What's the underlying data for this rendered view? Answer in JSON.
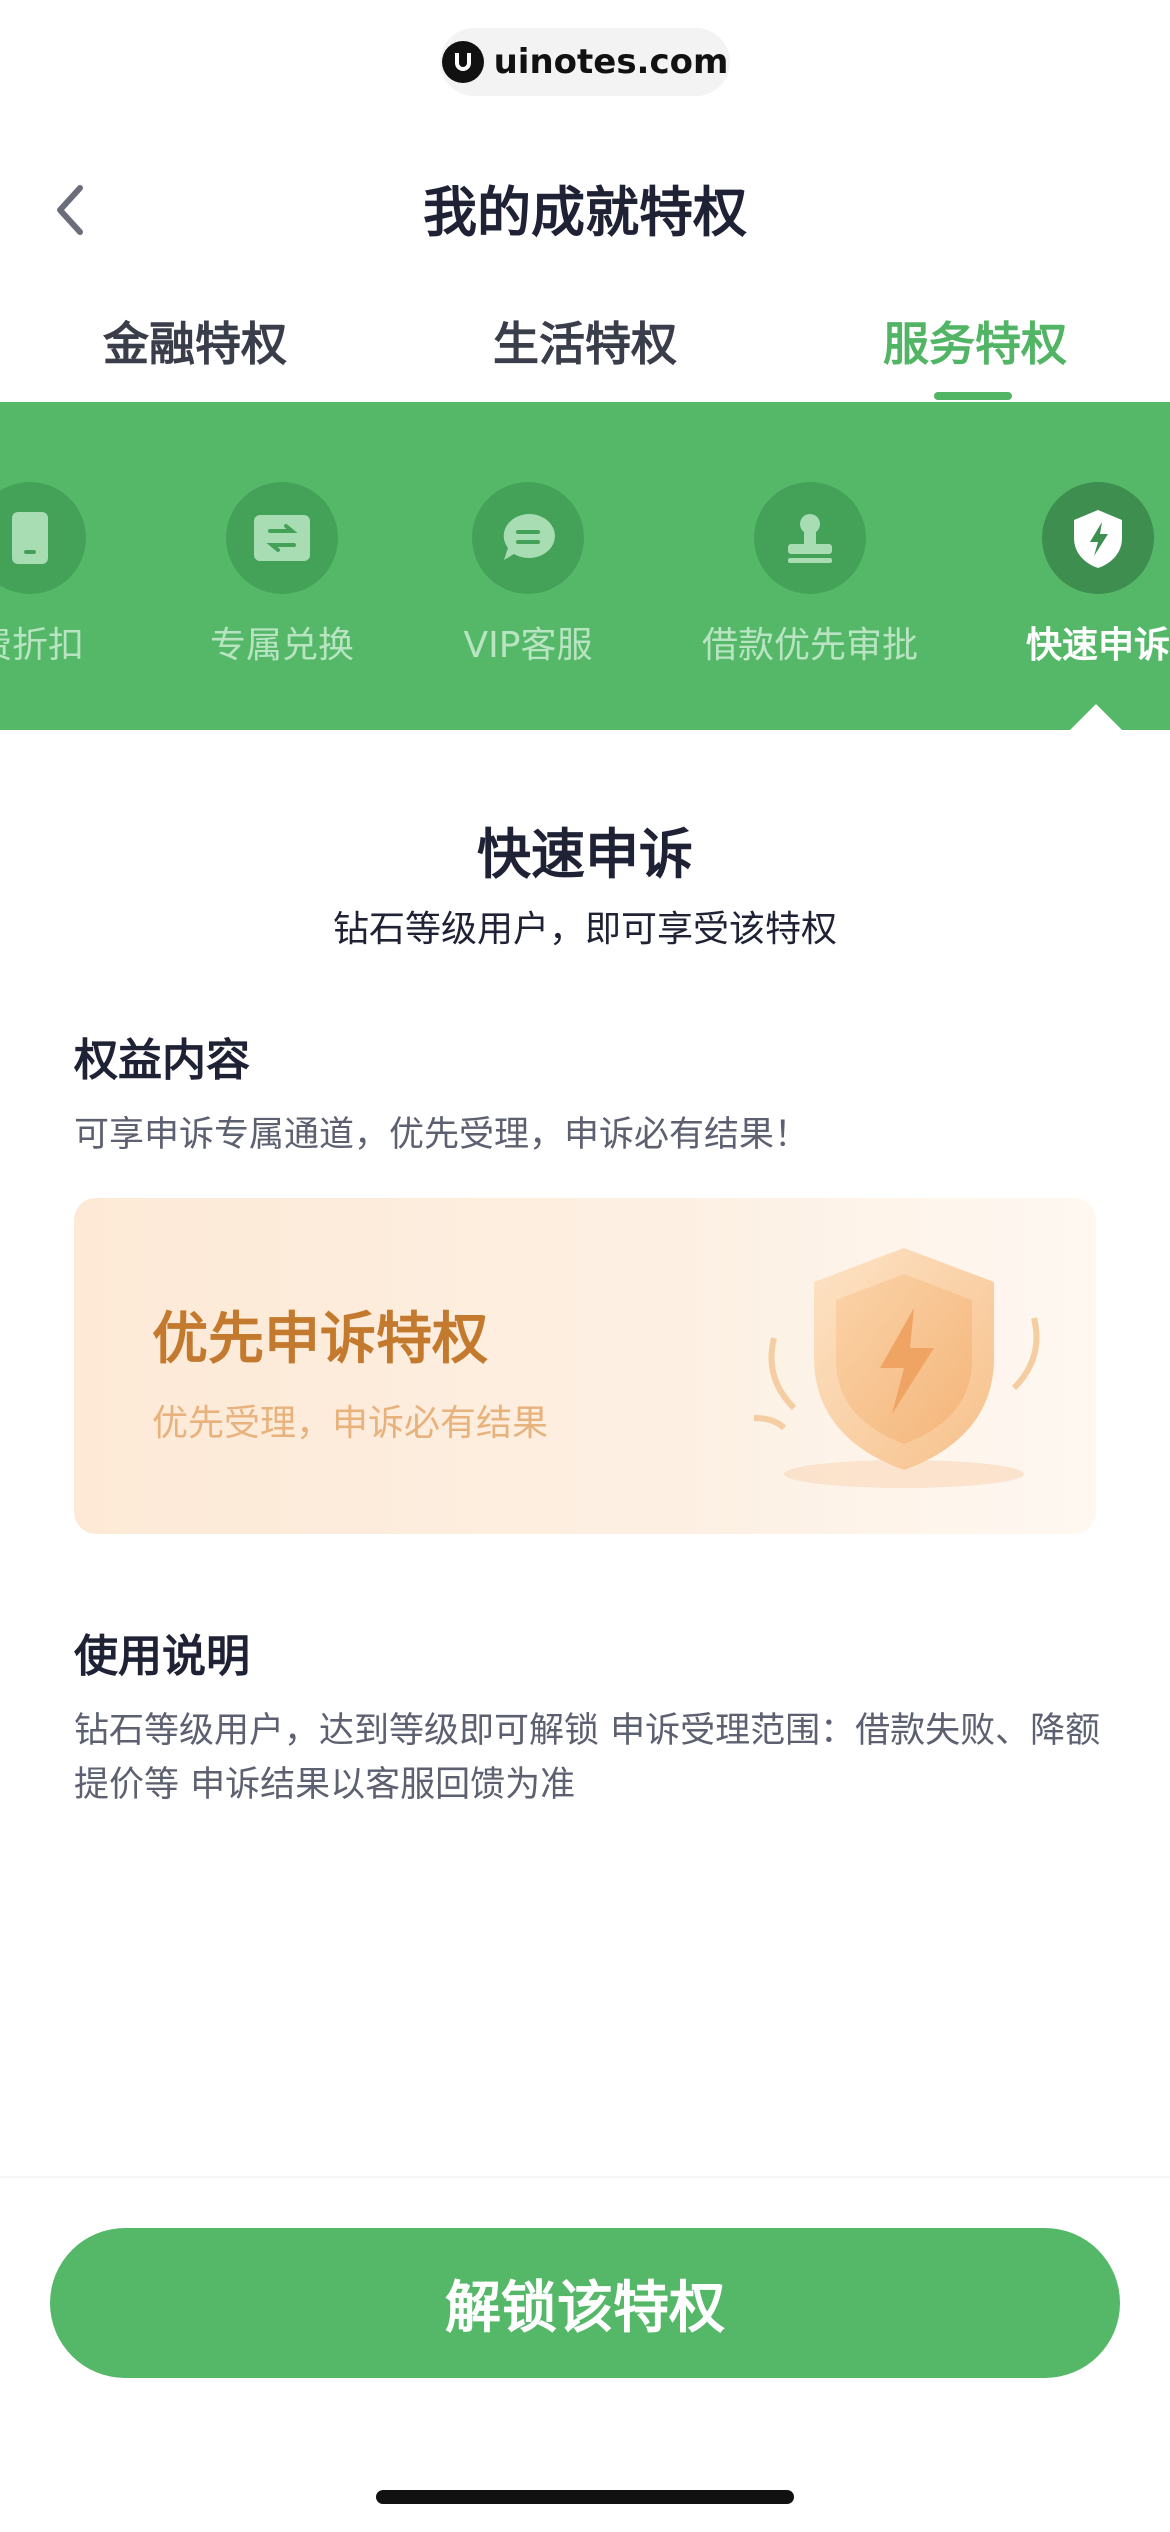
{
  "watermark": {
    "text": "uinotes.com"
  },
  "header": {
    "title": "我的成就特权"
  },
  "tabs": [
    {
      "label": "金融特权",
      "active": false
    },
    {
      "label": "生活特权",
      "active": false
    },
    {
      "label": "服务特权",
      "active": true
    }
  ],
  "privileges": [
    {
      "label": "费折扣",
      "icon": "phone-icon"
    },
    {
      "label": "专属兑换",
      "icon": "exchange-icon"
    },
    {
      "label": "VIP客服",
      "icon": "chat-icon"
    },
    {
      "label": "借款优先审批",
      "icon": "stamp-icon"
    },
    {
      "label": "快速申诉",
      "icon": "lightning-shield-icon",
      "active": true
    }
  ],
  "detail": {
    "title": "快速申诉",
    "subtitle": "钻石等级用户，即可享受该特权",
    "benefit_heading": "权益内容",
    "benefit_text": "可享申诉专属通道，优先受理，申诉必有结果！",
    "card_title": "优先申诉特权",
    "card_subtitle": "优先受理，申诉必有结果",
    "usage_heading": "使用说明",
    "usage_text": "钻石等级用户，达到等级即可解锁 申诉受理范围：借款失败、降额提价等 申诉结果以客服回馈为准"
  },
  "action": {
    "unlock_label": "解锁该特权"
  },
  "colors": {
    "accent": "#55b869",
    "card_title": "#c37a2e"
  }
}
